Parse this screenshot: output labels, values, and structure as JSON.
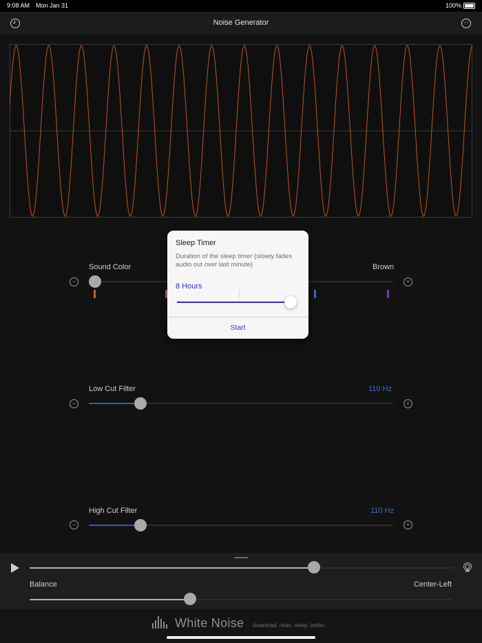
{
  "status_bar": {
    "time": "9:08 AM",
    "date": "Mon Jan 31",
    "battery": "100%"
  },
  "nav": {
    "title": "Noise Generator",
    "left_icon": "clock-icon",
    "right_icon": "more-icon"
  },
  "sound_color": {
    "label": "Sound Color",
    "value": "Brown",
    "level": 0.0,
    "tick_colors": [
      "#c8622a",
      "#b05aa0",
      "#2f6fd0",
      "#7a35b5"
    ]
  },
  "low_cut": {
    "label": "Low Cut Filter",
    "value": "110 Hz",
    "level": 0.17
  },
  "high_cut": {
    "label": "High Cut Filter",
    "value": "110 Hz",
    "level": 0.17
  },
  "popup": {
    "title": "Sleep Timer",
    "description": "Duration of the sleep timer (slowly fades audio out over last minute)",
    "duration": "8 Hours",
    "level": 1.0,
    "start_label": "Start"
  },
  "player": {
    "volume_level": 0.67,
    "balance_label": "Balance",
    "balance_value": "Center-Left",
    "balance_level": 0.38
  },
  "footer": {
    "brand": "White Noise",
    "tagline": "download. relax. sleep. better."
  },
  "colors": {
    "wave": "#c4541f",
    "accent": "#2b5fc7",
    "popup_accent": "#2f2fd0"
  }
}
